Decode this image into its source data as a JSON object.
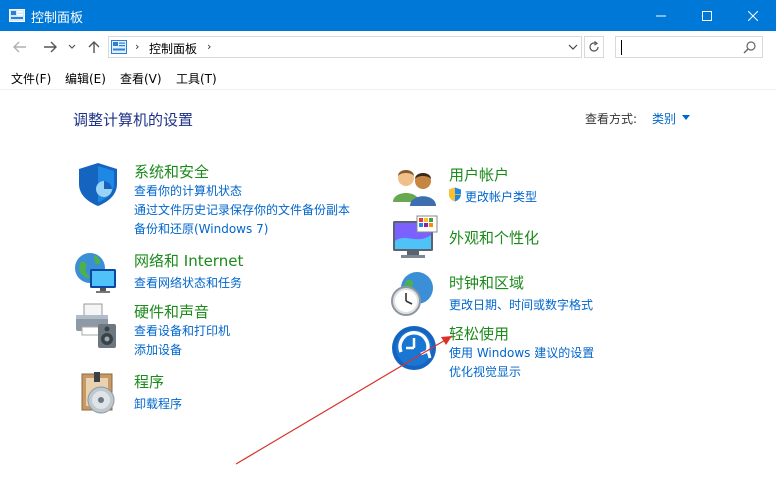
{
  "window": {
    "title": "控制面板",
    "icon": "control-panel-icon"
  },
  "address": {
    "breadcrumb": "控制面板",
    "search_placeholder": ""
  },
  "menu": [
    "文件(F)",
    "编辑(E)",
    "查看(V)",
    "工具(T)"
  ],
  "content": {
    "heading": "调整计算机的设置",
    "view_by_label": "查看方式:",
    "view_by_value": "类别"
  },
  "categories": [
    {
      "title": "系统和安全",
      "icon": "shield-icon",
      "links": [
        "查看你的计算机状态",
        "通过文件历史记录保存你的文件备份副本",
        "备份和还原(Windows 7)"
      ]
    },
    {
      "title": "网络和 Internet",
      "icon": "network-globe-icon",
      "links": [
        "查看网络状态和任务"
      ]
    },
    {
      "title": "硬件和声音",
      "icon": "printer-speaker-icon",
      "links": [
        "查看设备和打印机",
        "添加设备"
      ]
    },
    {
      "title": "程序",
      "icon": "programs-disc-icon",
      "links": [
        "卸载程序"
      ]
    },
    {
      "title": "用户帐户",
      "icon": "users-icon",
      "links": [
        "更改帐户类型"
      ]
    },
    {
      "title": "外观和个性化",
      "icon": "monitor-palette-icon",
      "links": []
    },
    {
      "title": "时钟和区域",
      "icon": "clock-globe-icon",
      "links": [
        "更改日期、时间或数字格式"
      ]
    },
    {
      "title": "轻松使用",
      "icon": "ease-of-access-icon",
      "links": [
        "使用 Windows 建议的设置",
        "优化视觉显示"
      ]
    }
  ],
  "colors": {
    "titlebar": "#0078d7",
    "category_title": "#1a8a1a",
    "link": "#0066cc",
    "heading": "#1e3287",
    "annotation_arrow": "#d9322b"
  }
}
